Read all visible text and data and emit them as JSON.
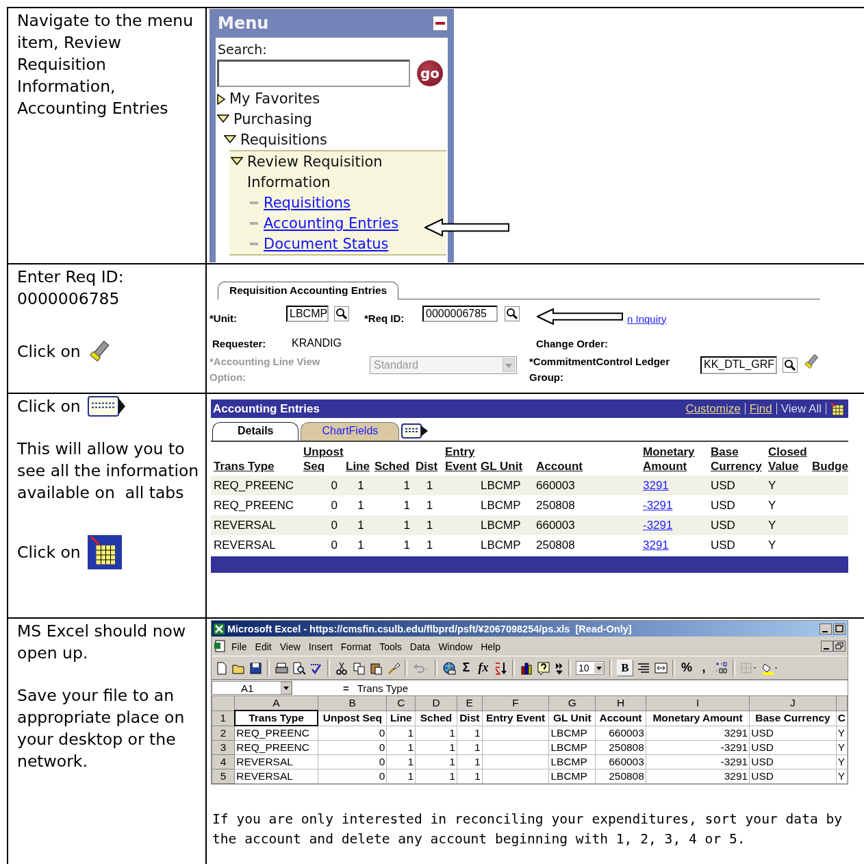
{
  "steps": [
    {
      "items": [
        {
          "kind": "para",
          "text": "Navigate to the menu item, Review Requisition Information, Accounting Entries"
        }
      ]
    },
    {
      "items": [
        {
          "kind": "para",
          "text": "Enter Req ID: 0000006785"
        },
        {
          "kind": "click",
          "text": "Click on"
        }
      ]
    },
    {
      "items": [
        {
          "kind": "click",
          "text": "Click on"
        },
        {
          "kind": "para",
          "text": "This will allow you to see all the information available on  all tabs"
        },
        {
          "kind": "click",
          "text": "Click on"
        }
      ]
    },
    {
      "items": [
        {
          "kind": "para",
          "text": "MS Excel should now open up."
        },
        {
          "kind": "para",
          "text": "Save your file to an appropriate place on your desktop or the network."
        }
      ]
    }
  ],
  "menu": {
    "title": "Menu",
    "search_label": "Search:",
    "go_button": "go",
    "tree": [
      {
        "label": "My Favorites",
        "expanded": false,
        "selected": false
      },
      {
        "label": "Purchasing",
        "expanded": true,
        "selected": false,
        "children": [
          {
            "label": "Requisitions",
            "expanded": true,
            "selected": false,
            "children": [
              {
                "label": "Review Requisition Information",
                "expanded": true,
                "selected": true,
                "children": [
                  {
                    "label": "Requisitions",
                    "kind": "link",
                    "selected": false
                  },
                  {
                    "label": "Accounting Entries",
                    "kind": "link",
                    "selected": false
                  },
                  {
                    "label": "Document Status",
                    "kind": "link",
                    "selected": false
                  }
                ]
              }
            ]
          }
        ]
      }
    ]
  },
  "requisition_form": {
    "tab": "Requisition Accounting Entries",
    "unit_label": "*Unit:",
    "unit": "LBCMP",
    "req_id_label": "*Req ID:",
    "req_id": "0000006785",
    "inquiry_link": "n Inquiry",
    "requester_label": "Requester:",
    "requester": "KRANDIG",
    "change_order_label": "Change Order:",
    "line_view": {
      "label": "*Accounting Line View Option:",
      "value": "Standard",
      "disabled": true
    },
    "ledger_group_label": "*CommitmentControl Ledger Group:",
    "ledger_group": "KK_DTL_GRF"
  },
  "accounting_entries": {
    "title": "Accounting Entries",
    "links": [
      {
        "label": "Customize",
        "kind": "link"
      },
      {
        "label": "Find",
        "kind": "link"
      },
      {
        "label": "View All",
        "kind": "plain"
      }
    ],
    "tabs": [
      {
        "label": "Details",
        "selected": true
      },
      {
        "label": "ChartFields",
        "selected": false
      }
    ],
    "columns": [
      "Trans Type",
      "Unpost Seq",
      "Line",
      "Sched",
      "Dist",
      "Entry Event",
      "GL Unit",
      "Account",
      "Monetary Amount",
      "Base Currency",
      "Closed Value",
      "Budge"
    ],
    "rows": [
      {
        "trans_type": "REQ_PREENC",
        "unpost_seq": "0",
        "line": "1",
        "sched": "1",
        "dist": "1",
        "gl_unit": "LBCMP",
        "account": "660003",
        "monetary_amount": "3291",
        "base_currency": "USD",
        "closed_value": "Y"
      },
      {
        "trans_type": "REQ_PREENC",
        "unpost_seq": "0",
        "line": "1",
        "sched": "1",
        "dist": "1",
        "gl_unit": "LBCMP",
        "account": "250808",
        "monetary_amount": "-3291",
        "base_currency": "USD",
        "closed_value": "Y"
      },
      {
        "trans_type": "REVERSAL",
        "unpost_seq": "0",
        "line": "1",
        "sched": "1",
        "dist": "1",
        "gl_unit": "LBCMP",
        "account": "660003",
        "monetary_amount": "-3291",
        "base_currency": "USD",
        "closed_value": "Y"
      },
      {
        "trans_type": "REVERSAL",
        "unpost_seq": "0",
        "line": "1",
        "sched": "1",
        "dist": "1",
        "gl_unit": "LBCMP",
        "account": "250808",
        "monetary_amount": "3291",
        "base_currency": "USD",
        "closed_value": "Y"
      }
    ]
  },
  "excel": {
    "title": "Microsoft Excel - https://cmsfin.csulb.edu/flbprd/psft/¥2067098254/ps.xls  [Read-Only]",
    "menus": [
      "File",
      "Edit",
      "View",
      "Insert",
      "Format",
      "Tools",
      "Data",
      "Window",
      "Help"
    ],
    "toolbar_texts": [
      "Σ",
      "fx",
      "%",
      ","
    ],
    "font_size": "10",
    "bold_button": "B",
    "name_box": "A1",
    "formula_sign": "=",
    "formula": "Trans Type",
    "column_letters": [
      "A",
      "B",
      "C",
      "D",
      "E",
      "F",
      "G",
      "H",
      "I",
      "J"
    ],
    "rows": [
      {
        "number": "1",
        "A": "Trans Type",
        "B": "Unpost Seq",
        "C": "Line",
        "D": "Sched",
        "E": "Dist",
        "F": "Entry Event",
        "G": "GL Unit",
        "H": "Account",
        "I": "Monetary Amount",
        "J": "Base Currency",
        "column_11": "C"
      },
      {
        "number": "2",
        "A": "REQ_PREENC",
        "B": "0",
        "C": "1",
        "D": "1",
        "E": "1",
        "G": "LBCMP",
        "H": "660003",
        "I": "3291",
        "J": "USD",
        "column_11": "Y"
      },
      {
        "number": "3",
        "A": "REQ_PREENC",
        "B": "0",
        "C": "1",
        "D": "1",
        "E": "1",
        "G": "LBCMP",
        "H": "250808",
        "I": "-3291",
        "J": "USD",
        "column_11": "Y"
      },
      {
        "number": "4",
        "A": "REVERSAL",
        "B": "0",
        "C": "1",
        "D": "1",
        "E": "1",
        "G": "LBCMP",
        "H": "660003",
        "I": "-3291",
        "J": "USD",
        "column_11": "Y"
      },
      {
        "number": "5",
        "A": "REVERSAL",
        "B": "0",
        "C": "1",
        "D": "1",
        "E": "1",
        "G": "LBCMP",
        "H": "250808",
        "I": "3291",
        "J": "USD",
        "column_11": "Y"
      }
    ]
  },
  "note": "If you are only interested in reconciling your expenditures, sort your data by the account and delete any account beginning with 1, 2, 3, 4 or 5."
}
